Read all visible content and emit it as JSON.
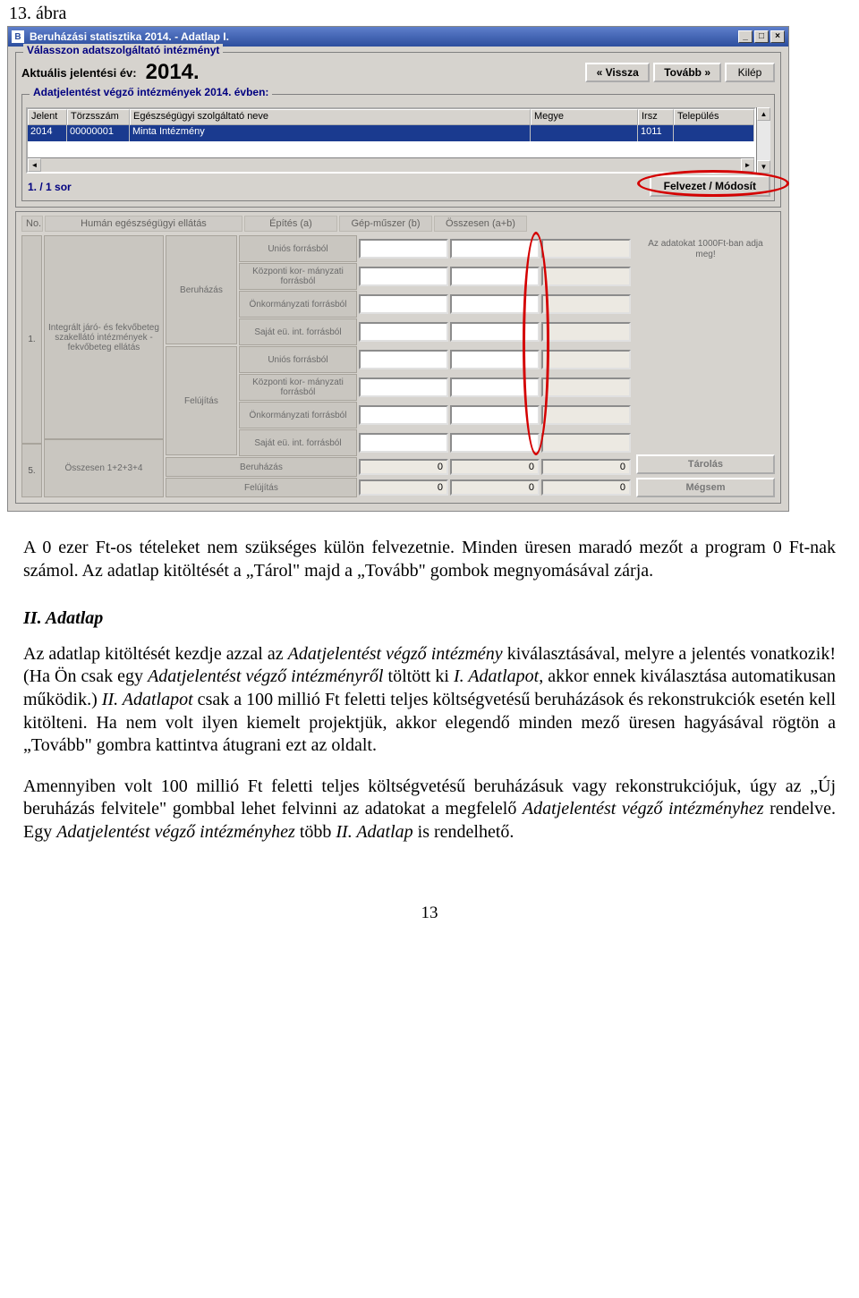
{
  "figure_caption": "13. ábra",
  "window": {
    "title": "Beruházási statisztika 2014. - Adatlap I.",
    "icon_letter": "B"
  },
  "group1": {
    "legend": "Válasszon adatszolgáltató intézményt",
    "year_label": "Aktuális jelentési év:",
    "year_value": "2014.",
    "btn_back": "« Vissza",
    "btn_next": "Tovább »",
    "btn_exit": "Kilép"
  },
  "subgroup": {
    "legend": "Adatjelentést végző intézmények  2014. évben:",
    "columns": {
      "jelent": "Jelent",
      "torzsszam": "Törzsszám",
      "nev": "Egészségügyi szolgáltató neve",
      "megye": "Megye",
      "irsz": "Irsz",
      "telepules": "Település"
    },
    "row": {
      "jelent": "2014",
      "torzsszam": "00000001",
      "nev": "Minta Intézmény",
      "megye": "",
      "irsz": "1011",
      "telepules": ""
    },
    "rowcount": "1. / 1 sor",
    "btn_felvezet": "Felvezet / Módosít"
  },
  "form": {
    "hdr_no": "No.",
    "hdr_ellatas": "Humán egészségügyi ellátás",
    "hdr_epites": "Építés (a)",
    "hdr_gep": "Gép-műszer (b)",
    "hdr_ossz": "Összesen (a+b)",
    "note": "Az adatokat 1000Ft-ban adja meg!",
    "no1": "1.",
    "no5": "5.",
    "ellatastext": "Integrált járó- és fekvőbeteg szakellátó intézmények - fekvőbeteg ellátás",
    "osszesen_label": "Összesen 1+2+3+4",
    "cat_beruhazas": "Beruházás",
    "cat_felujitas": "Felújítás",
    "src_unios": "Uniós forrásból",
    "src_kozponti": "Központi kor-\nmányzati forrásból",
    "src_onk": "Önkormányzati forrásból",
    "src_sajat": "Saját eü. int. forrásból",
    "zero": "0",
    "btn_tarolas": "Tárolás",
    "btn_megsem": "Mégsem"
  },
  "doc": {
    "p1": "A 0 ezer Ft-os tételeket nem szükséges külön felvezetnie. Minden üresen maradó mezőt a program 0 Ft-nak számol. Az adatlap kitöltését a „Tárol\" majd a „Tovább\" gombok megnyomásával zárja.",
    "h2": "II. Adatlap",
    "p2a": "Az adatlap kitöltését kezdje azzal az ",
    "p2b": "Adatjelentést végző intézmény",
    "p2c": " kiválasztásával, melyre a jelentés vonatkozik! (Ha Ön csak egy ",
    "p2d": "Adatjelentést végző intézményről",
    "p2e": " töltött ki ",
    "p2f": "I. Adatlapot",
    "p2g": ", akkor ennek kiválasztása automatikusan működik.) ",
    "p2h": "II. Adatlapot",
    "p2i": " csak a 100 millió Ft feletti teljes költségvetésű beruházások és rekonstrukciók esetén kell kitölteni. Ha nem volt ilyen kiemelt projektjük, akkor elegendő minden mező üresen hagyásával rögtön a „Tovább\" gombra kattintva átugrani ezt az oldalt.",
    "p3a": "Amennyiben volt 100 millió Ft feletti teljes költségvetésű beruházásuk vagy rekonstrukciójuk, úgy az „Új beruházás felvitele\" gombbal lehet felvinni az adatokat a megfelelő ",
    "p3b": "Adatjelentést végző intézményhez",
    "p3c": " rendelve. Egy ",
    "p3d": "Adatjelentést végző intézményhez",
    "p3e": " több ",
    "p3f": "II. Adatlap",
    "p3g": " is rendelhető.",
    "page_number": "13"
  }
}
